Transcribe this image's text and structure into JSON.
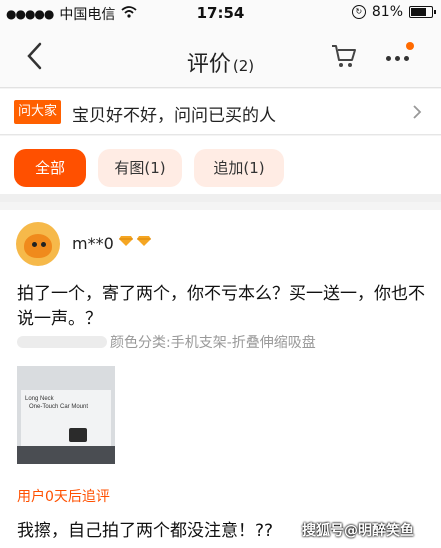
{
  "status_bar": {
    "signal": "●●●●●",
    "carrier": "中国电信",
    "wifi_icon": "wifi-icon",
    "time": "17:54",
    "battery": "81%",
    "battery_level": 0.81
  },
  "nav": {
    "title": "评价",
    "count": "(2)",
    "notification_color": "#ff6a00"
  },
  "ask": {
    "tag": "问大家",
    "text": "宝贝好不好，问问已买的人"
  },
  "filters": [
    {
      "label": "全部",
      "active": true
    },
    {
      "label": "有图(1)",
      "active": false
    },
    {
      "label": "追加(1)",
      "active": false
    }
  ],
  "review": {
    "username": "m**0",
    "content": "拍了一个，寄了两个，你不亏本么？买一送一，你也不说一声。？",
    "spec": "颜色分类:手机支架-折叠伸缩吸盘",
    "photo_text_1": "Long Neck",
    "photo_text_2": "One-Touch Car Mount",
    "followup_title": "用户0天后追评",
    "followup_text": "我擦，自己拍了两个都没注意！??"
  },
  "watermark": "搜狐号@明醉笑鱼",
  "colors": {
    "accent": "#ff5000",
    "chip_bg": "#ffece4"
  }
}
